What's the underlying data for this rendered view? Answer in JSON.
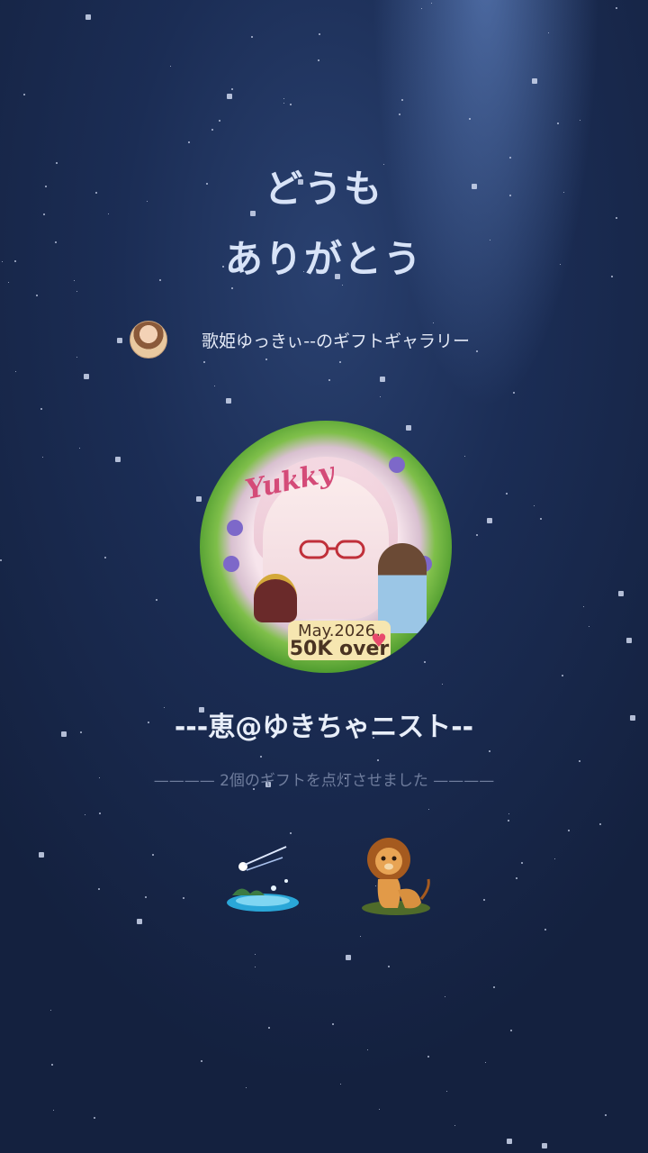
{
  "header": {
    "title_line1": "どうも",
    "title_line2": "ありがとう"
  },
  "gallery": {
    "title": "歌姫ゆっきぃ--のギフトギャラリー",
    "avatar_icon": "avatar-icon"
  },
  "badge": {
    "script_text": "Yukky",
    "date": "May.2026.",
    "milestone": "50K over"
  },
  "supporter": {
    "name": "---恵@ゆきちゃニスト--"
  },
  "gifts": {
    "summary": "———— 2個のギフトを点灯させました ————",
    "items": [
      {
        "icon": "shooting-star-lake-icon"
      },
      {
        "icon": "lion-icon"
      }
    ]
  },
  "colors": {
    "background_top": "#2a4170",
    "background_bottom": "#14213f",
    "title": "#d8e3f7",
    "muted": "#6f7d9d"
  }
}
